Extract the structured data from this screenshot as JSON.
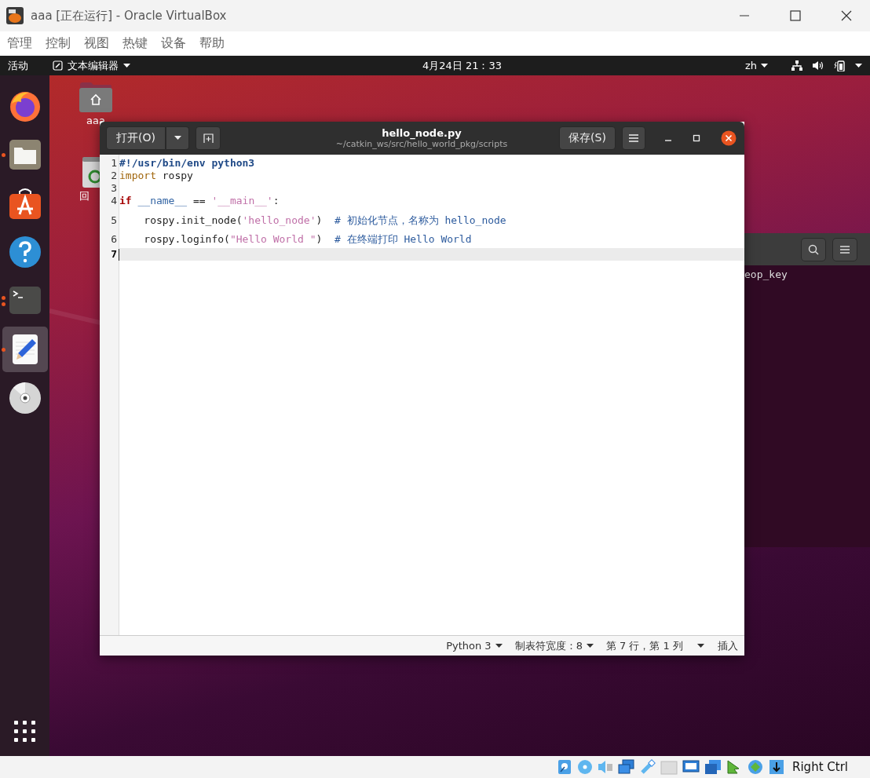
{
  "window": {
    "title": "aaa [正在运行] - Oracle VirtualBox"
  },
  "menu": [
    "管理",
    "控制",
    "视图",
    "热键",
    "设备",
    "帮助"
  ],
  "top_bar": {
    "activities": "活动",
    "app_menu": "文本编辑器",
    "clock": "4月24日  21：33",
    "input_method": "zh"
  },
  "dock": [
    {
      "kind": "firefox",
      "running": false,
      "multiple": false,
      "selected": false
    },
    {
      "kind": "files",
      "running": true,
      "multiple": false,
      "selected": false
    },
    {
      "kind": "software",
      "running": false,
      "multiple": false,
      "selected": false
    },
    {
      "kind": "help",
      "running": false,
      "multiple": false,
      "selected": false
    },
    {
      "kind": "terminal",
      "running": true,
      "multiple": true,
      "selected": false
    },
    {
      "kind": "editor",
      "running": true,
      "multiple": false,
      "selected": true
    },
    {
      "kind": "disc",
      "running": false,
      "multiple": false,
      "selected": false
    }
  ],
  "desktop_icons": [
    {
      "kind": "home-folder",
      "label": "aaa"
    },
    {
      "kind": "trash",
      "label": "回"
    }
  ],
  "terminal": {
    "text": "eop_key"
  },
  "editor": {
    "open_button": "打开(O)",
    "title": "hello_node.py",
    "subtitle": "~/catkin_ws/src/hello_world_pkg/scripts",
    "save_button": "保存(S)",
    "lines": [
      {
        "number": "1",
        "current": false,
        "tokens": [
          {
            "kind": "shebang",
            "text": "#!/usr/bin/env python3"
          }
        ]
      },
      {
        "number": "2",
        "current": false,
        "tokens": [
          {
            "kind": "keyword",
            "text": "import"
          },
          {
            "kind": "plain",
            "text": " rospy"
          }
        ]
      },
      {
        "number": "3",
        "current": false
      },
      {
        "number": "4",
        "current": false,
        "tokens": [
          {
            "kind": "control",
            "text": "if "
          },
          {
            "kind": "builtin",
            "text": "__name__"
          },
          {
            "kind": "plain",
            "text": " == "
          },
          {
            "kind": "string",
            "text": "'__main__'"
          },
          {
            "kind": "plain",
            "text": ":"
          }
        ]
      },
      {
        "number": "5",
        "current": false,
        "tokens": [
          {
            "kind": "plain",
            "text": "    rospy.init_node("
          },
          {
            "kind": "string",
            "text": "'hello_node'"
          },
          {
            "kind": "plain",
            "text": ")  "
          },
          {
            "kind": "comment",
            "text": "# 初始化节点，名称为 hello_node"
          }
        ]
      },
      {
        "number": "6",
        "current": false,
        "tokens": [
          {
            "kind": "plain",
            "text": "    rospy.loginfo("
          },
          {
            "kind": "string",
            "text": "\"Hello World \""
          },
          {
            "kind": "plain",
            "text": ")  "
          },
          {
            "kind": "comment",
            "text": "# 在终端打印 Hello World"
          }
        ]
      },
      {
        "number": "7",
        "current": true
      }
    ],
    "status": {
      "language": "Python 3",
      "tab_width": "制表符宽度：8",
      "position": "第 7 行，第 1 列",
      "mode": "插入"
    }
  },
  "status_bar": {
    "host_key": "Right Ctrl"
  }
}
